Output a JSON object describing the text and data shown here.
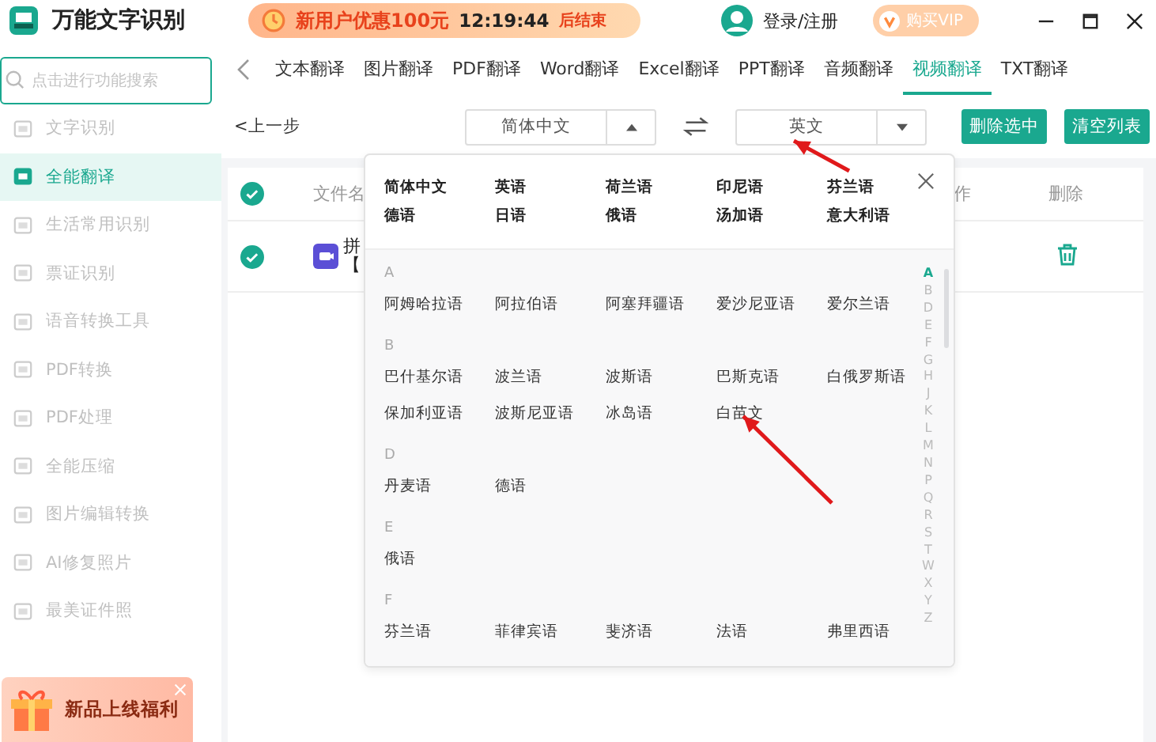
{
  "app": {
    "title": "万能文字识别"
  },
  "promo": {
    "label": "新用户优惠100元",
    "time": "12:19:44",
    "suffix": "后结束"
  },
  "user": {
    "login": "登录/注册"
  },
  "vip": {
    "label": "购买VIP"
  },
  "sidebar": {
    "search": {
      "placeholder": "点击进行功能搜索"
    },
    "items": [
      {
        "label": "文字识别",
        "selected": false
      },
      {
        "label": "全能翻译",
        "selected": true
      },
      {
        "label": "生活常用识别",
        "selected": false
      },
      {
        "label": "票证识别",
        "selected": false
      },
      {
        "label": "语音转换工具",
        "selected": false
      },
      {
        "label": "PDF转换",
        "selected": false
      },
      {
        "label": "PDF处理",
        "selected": false
      },
      {
        "label": "全能压缩",
        "selected": false
      },
      {
        "label": "图片编辑转换",
        "selected": false
      },
      {
        "label": "AI修复照片",
        "selected": false
      },
      {
        "label": "最美证件照",
        "selected": false
      }
    ],
    "banner": {
      "title": "新品上线福利"
    }
  },
  "tabs": [
    {
      "label": "文本翻译",
      "selected": false
    },
    {
      "label": "图片翻译",
      "selected": false
    },
    {
      "label": "PDF翻译",
      "selected": false
    },
    {
      "label": "Word翻译",
      "selected": false
    },
    {
      "label": "Excel翻译",
      "selected": false
    },
    {
      "label": "PPT翻译",
      "selected": false
    },
    {
      "label": "音频翻译",
      "selected": false
    },
    {
      "label": "视频翻译",
      "selected": true
    },
    {
      "label": "TXT翻译",
      "selected": false
    }
  ],
  "toolbar": {
    "back": "<上一步",
    "source": "简体中文",
    "target": "英文",
    "buttons": [
      "删除选中",
      "清空列表"
    ]
  },
  "table": {
    "header_checked": true,
    "columns": [
      "文件名",
      "作",
      "删除"
    ],
    "rows": [
      {
        "checked": true,
        "name_lines": [
          "拼",
          "【"
        ]
      }
    ]
  },
  "language_popup": {
    "common": [
      "简体中文",
      "英语",
      "荷兰语",
      "印尼语",
      "芬兰语",
      "德语",
      "日语",
      "俄语",
      "汤加语",
      "意大利语"
    ],
    "groups": [
      {
        "letter": "A",
        "languages": [
          "阿姆哈拉语",
          "阿拉伯语",
          "阿塞拜疆语",
          "爱沙尼亚语",
          "爱尔兰语"
        ]
      },
      {
        "letter": "B",
        "languages": [
          "巴什基尔语",
          "波兰语",
          "波斯语",
          "巴斯克语",
          "白俄罗斯语",
          "保加利亚语",
          "波斯尼亚语",
          "冰岛语",
          "白苗文"
        ]
      },
      {
        "letter": "D",
        "languages": [
          "丹麦语",
          "德语"
        ]
      },
      {
        "letter": "E",
        "languages": [
          "俄语"
        ]
      },
      {
        "letter": "F",
        "languages": [
          "芬兰语",
          "菲律宾语",
          "斐济语",
          "法语",
          "弗里西语"
        ]
      }
    ],
    "index": [
      {
        "letter": "A",
        "selected": true
      },
      {
        "letter": "B",
        "selected": false
      },
      {
        "letter": "D",
        "selected": false
      },
      {
        "letter": "E",
        "selected": false
      },
      {
        "letter": "F",
        "selected": false
      },
      {
        "letter": "G",
        "selected": false
      },
      {
        "letter": "H",
        "selected": false
      },
      {
        "letter": "J",
        "selected": false
      },
      {
        "letter": "K",
        "selected": false
      },
      {
        "letter": "L",
        "selected": false
      },
      {
        "letter": "M",
        "selected": false
      },
      {
        "letter": "N",
        "selected": false
      },
      {
        "letter": "P",
        "selected": false
      },
      {
        "letter": "Q",
        "selected": false
      },
      {
        "letter": "R",
        "selected": false
      },
      {
        "letter": "S",
        "selected": false
      },
      {
        "letter": "T",
        "selected": false
      },
      {
        "letter": "W",
        "selected": false
      },
      {
        "letter": "X",
        "selected": false
      },
      {
        "letter": "Y",
        "selected": false
      },
      {
        "letter": "Z",
        "selected": false
      }
    ]
  },
  "annotations": [
    {
      "kind": "arrow"
    },
    {
      "kind": "arrow"
    }
  ]
}
